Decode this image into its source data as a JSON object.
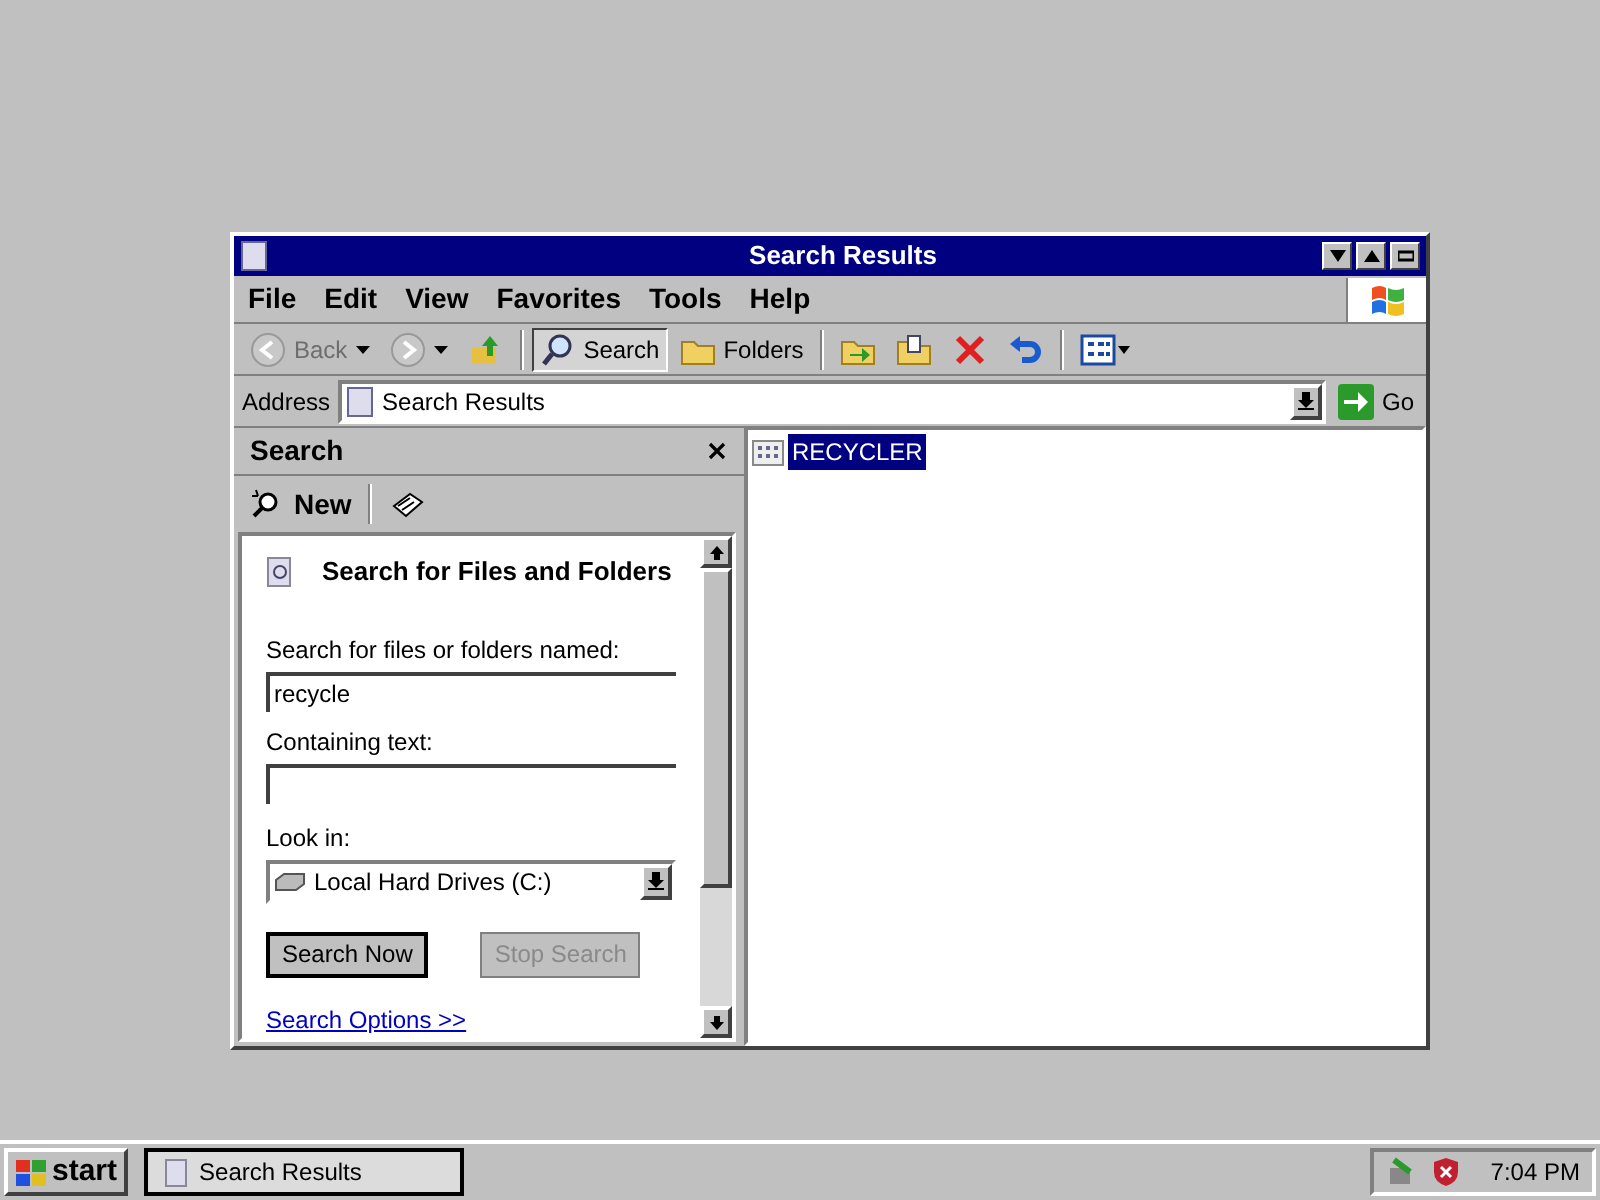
{
  "window": {
    "title": "Search Results"
  },
  "menu": [
    "File",
    "Edit",
    "View",
    "Favorites",
    "Tools",
    "Help"
  ],
  "toolbar": [
    {
      "kind": "back",
      "label": "Back",
      "disabled": true
    },
    {
      "kind": "forward",
      "disabled": true
    },
    {
      "kind": "up"
    },
    {
      "kind": "search",
      "label": "Search",
      "selected": true
    },
    {
      "kind": "folders",
      "label": "Folders",
      "selected": false
    },
    {
      "kind": "move"
    },
    {
      "kind": "copy"
    },
    {
      "kind": "delete"
    },
    {
      "kind": "undo"
    },
    {
      "kind": "views"
    }
  ],
  "address": {
    "label": "Address",
    "value": "Search Results",
    "go": "Go"
  },
  "search_pane": {
    "title": "Search",
    "new_label": "New",
    "heading": "Search for Files and Folders",
    "name_field": {
      "label": "Search for files or folders named:",
      "value": "recycle"
    },
    "text_field": {
      "label": "Containing text:"
    },
    "look_in": {
      "label": "Look in:",
      "value": "Local Hard Drives (C:)"
    },
    "buttons": [
      {
        "label": "Search Now",
        "disabled": false
      },
      {
        "label": "Stop Search",
        "disabled": true
      }
    ],
    "link": "Search Options >>"
  },
  "results": [
    {
      "name": "RECYCLER",
      "selected": true
    }
  ],
  "taskbar": {
    "start": "start",
    "tasks": [
      {
        "label": "Search Results",
        "selected": true
      }
    ],
    "clock": "7:04 PM"
  }
}
